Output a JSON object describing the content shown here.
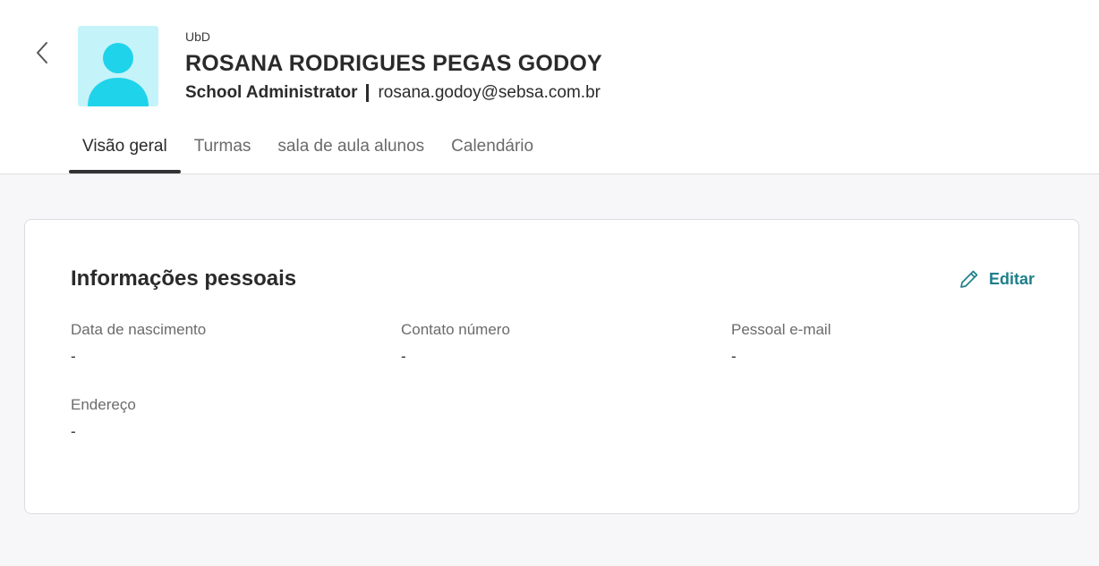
{
  "header": {
    "app_label": "UbD",
    "user_name": "ROSANA RODRIGUES PEGAS GODOY",
    "role": "School Administrator",
    "email": "rosana.godoy@sebsa.com.br"
  },
  "tabs": [
    {
      "label": "Visão geral",
      "active": true
    },
    {
      "label": "Turmas",
      "active": false
    },
    {
      "label": "sala de aula alunos",
      "active": false
    },
    {
      "label": "Calendário",
      "active": false
    }
  ],
  "personal_info": {
    "title": "Informações pessoais",
    "edit_label": "Editar",
    "fields": [
      {
        "label": "Data de nascimento",
        "value": "-"
      },
      {
        "label": "Contato número",
        "value": "-"
      },
      {
        "label": "Pessoal e-mail",
        "value": "-"
      },
      {
        "label": "Endereço",
        "value": "-"
      }
    ]
  },
  "colors": {
    "accent": "#1e7f8a",
    "avatar_bg": "#c5f3fa",
    "avatar_fg": "#1fd3ea",
    "page_bg": "#f7f7f9"
  },
  "icons": {
    "back": "chevron-left-icon",
    "avatar": "user-silhouette-icon",
    "edit": "pencil-icon"
  }
}
